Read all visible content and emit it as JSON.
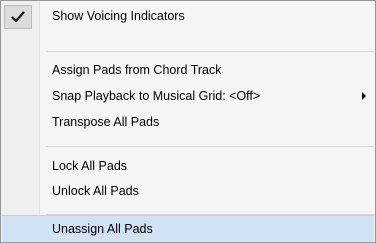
{
  "menu": {
    "items": [
      {
        "label": "Show Voicing Indicators",
        "checked": true
      },
      {
        "label": "Assign Pads from Chord Track"
      },
      {
        "label": "Snap Playback to Musical Grid: <Off>",
        "has_submenu": true
      },
      {
        "label": "Transpose All Pads"
      },
      {
        "label": "Lock All Pads"
      },
      {
        "label": "Unlock All Pads"
      },
      {
        "label": "Unassign All Pads",
        "highlighted": true
      }
    ]
  },
  "colors": {
    "menu_bg": "#f5f5f5",
    "gutter_bg": "#efefef",
    "border": "#979797",
    "highlight_bg": "#d0e2f4",
    "separator": "#d9d9d9"
  },
  "icons": {
    "check": "check-icon",
    "submenu": "submenu-arrow-icon"
  }
}
